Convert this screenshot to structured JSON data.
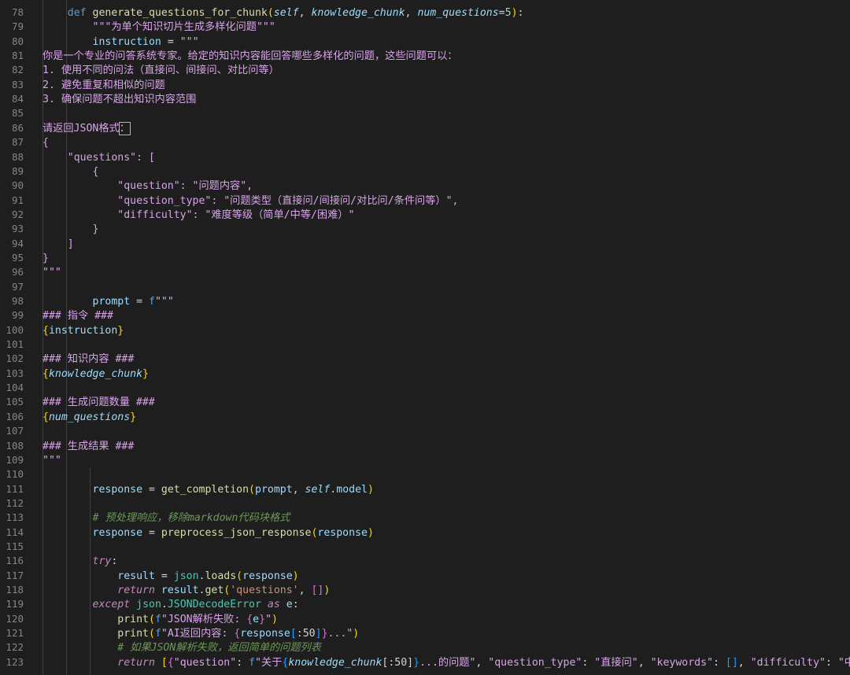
{
  "editor": {
    "lines": [
      {
        "n": "78",
        "tokens": [
          [
            "    ",
            ""
          ],
          [
            "def ",
            "t-kw"
          ],
          [
            "generate_questions_for_chunk",
            "t-fn"
          ],
          [
            "(",
            "t-br1"
          ],
          [
            "self",
            "t-self"
          ],
          [
            ", ",
            "t-op"
          ],
          [
            "knowledge_chunk",
            "t-par"
          ],
          [
            ", ",
            "t-op"
          ],
          [
            "num_questions",
            "t-par"
          ],
          [
            "=",
            "t-op"
          ],
          [
            "5",
            "t-num"
          ],
          [
            ")",
            "t-br1"
          ],
          [
            ":",
            "t-op"
          ]
        ]
      },
      {
        "n": "79",
        "tokens": [
          [
            "        ",
            ""
          ],
          [
            "\"\"\"为单个知识切片生成多样化问题\"\"\"",
            "t-pink"
          ]
        ]
      },
      {
        "n": "80",
        "tokens": [
          [
            "        ",
            ""
          ],
          [
            "instruction",
            "t-var"
          ],
          [
            " = ",
            "t-op"
          ],
          [
            "\"\"\"",
            "t-pink"
          ]
        ]
      },
      {
        "n": "81",
        "tokens": [
          [
            "你是一个专业的问答系统专家。给定的知识内容能回答哪些多样化的问题，这些问题可以：",
            "t-pink"
          ]
        ]
      },
      {
        "n": "82",
        "tokens": [
          [
            "1. 使用不同的问法（直接问、间接问、对比问等）",
            "t-pink"
          ]
        ]
      },
      {
        "n": "83",
        "tokens": [
          [
            "2. 避免重复和相似的问题",
            "t-pink"
          ]
        ]
      },
      {
        "n": "84",
        "tokens": [
          [
            "3. 确保问题不超出知识内容范围",
            "t-pink"
          ]
        ]
      },
      {
        "n": "85",
        "tokens": []
      },
      {
        "n": "86",
        "tokens": [
          [
            "请返回JSON格式",
            "t-pink"
          ],
          [
            "：",
            "t-pink cursor-box"
          ]
        ]
      },
      {
        "n": "87",
        "tokens": [
          [
            "{",
            "t-pink"
          ]
        ]
      },
      {
        "n": "88",
        "tokens": [
          [
            "    \"questions\": [",
            "t-pink"
          ]
        ]
      },
      {
        "n": "89",
        "tokens": [
          [
            "        {",
            "t-pink"
          ]
        ]
      },
      {
        "n": "90",
        "tokens": [
          [
            "            \"question\": \"问题内容\",",
            "t-pink"
          ]
        ]
      },
      {
        "n": "91",
        "tokens": [
          [
            "            \"question_type\": \"问题类型（直接问/间接问/对比问/条件问等）\",",
            "t-pink"
          ]
        ]
      },
      {
        "n": "92",
        "tokens": [
          [
            "            \"difficulty\": \"难度等级（简单/中等/困难）\"",
            "t-pink"
          ]
        ]
      },
      {
        "n": "93",
        "tokens": [
          [
            "        }",
            "t-pink"
          ]
        ]
      },
      {
        "n": "94",
        "tokens": [
          [
            "    ]",
            "t-pink"
          ]
        ]
      },
      {
        "n": "95",
        "tokens": [
          [
            "}",
            "t-pink"
          ]
        ]
      },
      {
        "n": "96",
        "tokens": [
          [
            "\"\"\"",
            "t-pink"
          ]
        ]
      },
      {
        "n": "97",
        "tokens": []
      },
      {
        "n": "98",
        "tokens": [
          [
            "        ",
            ""
          ],
          [
            "prompt",
            "t-var"
          ],
          [
            " = ",
            "t-op"
          ],
          [
            "f",
            "t-kw"
          ],
          [
            "\"\"\"",
            "t-pink"
          ]
        ]
      },
      {
        "n": "99",
        "tokens": [
          [
            "### 指令 ###",
            "t-pink"
          ]
        ]
      },
      {
        "n": "100",
        "tokens": [
          [
            "{",
            "t-br1"
          ],
          [
            "instruction",
            "t-var"
          ],
          [
            "}",
            "t-br1"
          ]
        ]
      },
      {
        "n": "101",
        "tokens": []
      },
      {
        "n": "102",
        "tokens": [
          [
            "### 知识内容 ###",
            "t-pink"
          ]
        ]
      },
      {
        "n": "103",
        "tokens": [
          [
            "{",
            "t-br1"
          ],
          [
            "knowledge_chunk",
            "t-par"
          ],
          [
            "}",
            "t-br1"
          ]
        ]
      },
      {
        "n": "104",
        "tokens": []
      },
      {
        "n": "105",
        "tokens": [
          [
            "### 生成问题数量 ###",
            "t-pink"
          ]
        ]
      },
      {
        "n": "106",
        "tokens": [
          [
            "{",
            "t-br1"
          ],
          [
            "num_questions",
            "t-par"
          ],
          [
            "}",
            "t-br1"
          ]
        ]
      },
      {
        "n": "107",
        "tokens": []
      },
      {
        "n": "108",
        "tokens": [
          [
            "### 生成结果 ###",
            "t-pink"
          ]
        ]
      },
      {
        "n": "109",
        "tokens": [
          [
            "\"\"\"",
            "t-pink"
          ]
        ]
      },
      {
        "n": "110",
        "tokens": []
      },
      {
        "n": "111",
        "tokens": [
          [
            "        ",
            ""
          ],
          [
            "response",
            "t-var"
          ],
          [
            " = ",
            "t-op"
          ],
          [
            "get_completion",
            "t-fn"
          ],
          [
            "(",
            "t-br1"
          ],
          [
            "prompt",
            "t-var"
          ],
          [
            ", ",
            "t-op"
          ],
          [
            "self",
            "t-self"
          ],
          [
            ".",
            "t-op"
          ],
          [
            "model",
            "t-var"
          ],
          [
            ")",
            "t-br1"
          ]
        ]
      },
      {
        "n": "112",
        "tokens": []
      },
      {
        "n": "113",
        "tokens": [
          [
            "        ",
            ""
          ],
          [
            "# 预处理响应，移除markdown代码块格式",
            "t-com"
          ]
        ]
      },
      {
        "n": "114",
        "tokens": [
          [
            "        ",
            ""
          ],
          [
            "response",
            "t-var"
          ],
          [
            " = ",
            "t-op"
          ],
          [
            "preprocess_json_response",
            "t-fn"
          ],
          [
            "(",
            "t-br1"
          ],
          [
            "response",
            "t-var"
          ],
          [
            ")",
            "t-br1"
          ]
        ]
      },
      {
        "n": "115",
        "tokens": []
      },
      {
        "n": "116",
        "tokens": [
          [
            "        ",
            ""
          ],
          [
            "try",
            "t-ctl"
          ],
          [
            ":",
            "t-op"
          ]
        ]
      },
      {
        "n": "117",
        "tokens": [
          [
            "            ",
            ""
          ],
          [
            "result",
            "t-var"
          ],
          [
            " = ",
            "t-op"
          ],
          [
            "json",
            "t-mod"
          ],
          [
            ".",
            "t-op"
          ],
          [
            "loads",
            "t-fn"
          ],
          [
            "(",
            "t-br1"
          ],
          [
            "response",
            "t-var"
          ],
          [
            ")",
            "t-br1"
          ]
        ]
      },
      {
        "n": "118",
        "tokens": [
          [
            "            ",
            ""
          ],
          [
            "return",
            "t-ctl"
          ],
          [
            " ",
            ""
          ],
          [
            "result",
            "t-var"
          ],
          [
            ".",
            "t-op"
          ],
          [
            "get",
            "t-fn"
          ],
          [
            "(",
            "t-br1"
          ],
          [
            "'questions'",
            "t-str"
          ],
          [
            ", ",
            "t-op"
          ],
          [
            "[]",
            "t-br2"
          ],
          [
            ")",
            "t-br1"
          ]
        ]
      },
      {
        "n": "119",
        "tokens": [
          [
            "        ",
            ""
          ],
          [
            "except",
            "t-ctl"
          ],
          [
            " ",
            ""
          ],
          [
            "json",
            "t-mod"
          ],
          [
            ".",
            "t-op"
          ],
          [
            "JSONDecodeError",
            "t-cls"
          ],
          [
            " ",
            ""
          ],
          [
            "as",
            "t-ctl"
          ],
          [
            " ",
            ""
          ],
          [
            "e",
            "t-var"
          ],
          [
            ":",
            "t-op"
          ]
        ]
      },
      {
        "n": "120",
        "tokens": [
          [
            "            ",
            ""
          ],
          [
            "print",
            "t-fn"
          ],
          [
            "(",
            "t-br1"
          ],
          [
            "f",
            "t-kw"
          ],
          [
            "\"JSON解析失败: ",
            "t-pink"
          ],
          [
            "{",
            "t-br2"
          ],
          [
            "e",
            "t-var"
          ],
          [
            "}",
            "t-br2"
          ],
          [
            "\"",
            "t-pink"
          ],
          [
            ")",
            "t-br1"
          ]
        ]
      },
      {
        "n": "121",
        "tokens": [
          [
            "            ",
            ""
          ],
          [
            "print",
            "t-fn"
          ],
          [
            "(",
            "t-br1"
          ],
          [
            "f",
            "t-kw"
          ],
          [
            "\"AI返回内容: ",
            "t-pink"
          ],
          [
            "{",
            "t-br2"
          ],
          [
            "response",
            "t-var"
          ],
          [
            "[",
            "t-br3"
          ],
          [
            ":50",
            "t-op"
          ],
          [
            "]",
            "t-br3"
          ],
          [
            "}",
            "t-br2"
          ],
          [
            "...\"",
            "t-pink"
          ],
          [
            ")",
            "t-br1"
          ]
        ]
      },
      {
        "n": "122",
        "tokens": [
          [
            "            ",
            ""
          ],
          [
            "# 如果JSON解析失败，返回简单的问题列表",
            "t-com"
          ]
        ]
      },
      {
        "n": "123",
        "tokens": [
          [
            "            ",
            ""
          ],
          [
            "return",
            "t-ctl"
          ],
          [
            " ",
            ""
          ],
          [
            "[",
            "t-br1"
          ],
          [
            "{",
            "t-br2"
          ],
          [
            "\"question\"",
            "t-pink"
          ],
          [
            ": ",
            "t-op"
          ],
          [
            "f",
            "t-kw"
          ],
          [
            "\"关于",
            "t-pink"
          ],
          [
            "{",
            "t-br3"
          ],
          [
            "knowledge_chunk",
            "t-par"
          ],
          [
            "[:50]",
            "t-op"
          ],
          [
            "}",
            "t-br3"
          ],
          [
            "...的问题\"",
            "t-pink"
          ],
          [
            ", ",
            "t-op"
          ],
          [
            "\"question_type\"",
            "t-pink"
          ],
          [
            ": ",
            "t-op"
          ],
          [
            "\"直接问\"",
            "t-pink"
          ],
          [
            ", ",
            "t-op"
          ],
          [
            "\"keywords\"",
            "t-pink"
          ],
          [
            ": ",
            "t-op"
          ],
          [
            "[]",
            "t-br3"
          ],
          [
            ", ",
            "t-op"
          ],
          [
            "\"difficulty\"",
            "t-pink"
          ],
          [
            ": ",
            "t-op"
          ],
          [
            "\"中等\"",
            "t-pink"
          ],
          [
            "}",
            "t-br2"
          ],
          [
            "]",
            "t-br1"
          ]
        ]
      }
    ]
  }
}
